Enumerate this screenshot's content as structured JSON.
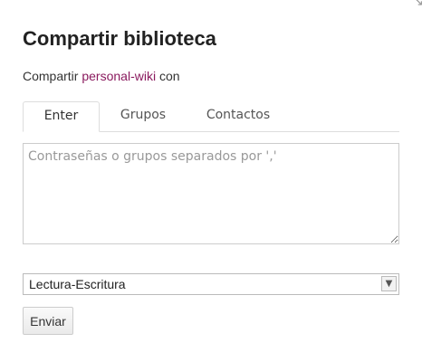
{
  "dialog": {
    "title": "Compartir biblioteca",
    "close_glyph": "↘"
  },
  "subtitle": {
    "prefix": "Compartir ",
    "library_name": "personal-wiki",
    "suffix": " con"
  },
  "tabs": [
    {
      "label": "Enter",
      "active": true
    },
    {
      "label": "Grupos",
      "active": false
    },
    {
      "label": "Contactos",
      "active": false
    }
  ],
  "share_input": {
    "value": "",
    "placeholder": "Contraseñas o grupos separados por ','"
  },
  "permission_select": {
    "selected": "Lectura-Escritura",
    "arrow_icon": "chevron-down-icon",
    "arrow_glyph": "⌵"
  },
  "submit": {
    "label": "Enviar"
  },
  "colors": {
    "link": "#8a1a5e",
    "border": "#dddddd",
    "placeholder": "#999999"
  }
}
